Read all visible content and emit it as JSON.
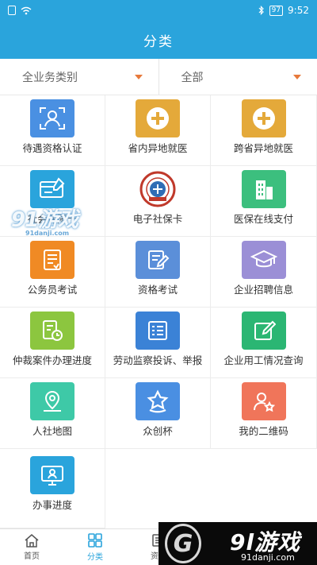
{
  "status_bar": {
    "battery": "97",
    "time": "9:52"
  },
  "header": {
    "title": "分类"
  },
  "filters": [
    {
      "label": "全业务类别"
    },
    {
      "label": "全部"
    }
  ],
  "services": [
    {
      "label": "待遇资格认证",
      "icon": "face-scan-icon",
      "color": "#4a90e2"
    },
    {
      "label": "省内异地就医",
      "icon": "medical-cross-icon",
      "color": "#e4a93a"
    },
    {
      "label": "跨省异地就医",
      "icon": "medical-cross-icon",
      "color": "#e4a93a"
    },
    {
      "label": "社会保障卡",
      "icon": "card-icon",
      "color": "#2aa4dc"
    },
    {
      "label": "电子社保卡",
      "icon": "social-security-seal-icon",
      "color": "#c0392b"
    },
    {
      "label": "医保在线支付",
      "icon": "building-icon",
      "color": "#3cbf7e"
    },
    {
      "label": "公务员考试",
      "icon": "exam-paper-icon",
      "color": "#f08a24"
    },
    {
      "label": "资格考试",
      "icon": "edit-document-icon",
      "color": "#5b8fd9"
    },
    {
      "label": "企业招聘信息",
      "icon": "graduation-cap-icon",
      "color": "#9b8fd6"
    },
    {
      "label": "仲裁案件办理进度",
      "icon": "document-clock-icon",
      "color": "#8cc63f"
    },
    {
      "label": "劳动监察投诉、举报",
      "icon": "complaint-list-icon",
      "color": "#3b82d6"
    },
    {
      "label": "企业用工情况查询",
      "icon": "pen-edit-icon",
      "color": "#2bb673"
    },
    {
      "label": "人社地图",
      "icon": "map-pin-icon",
      "color": "#3ec9a7"
    },
    {
      "label": "众创杯",
      "icon": "star-cup-icon",
      "color": "#4a8fe2"
    },
    {
      "label": "我的二维码",
      "icon": "user-star-icon",
      "color": "#f0755a"
    },
    {
      "label": "办事进度",
      "icon": "monitor-user-icon",
      "color": "#2aa4dc"
    }
  ],
  "watermark": {
    "text": "91游戏",
    "sub": "91danji.com"
  },
  "tabs": [
    {
      "label": "首页",
      "icon": "home-icon"
    },
    {
      "label": "分类",
      "icon": "grid-icon"
    },
    {
      "label": "资讯",
      "icon": "news-icon"
    }
  ],
  "brand": {
    "mark": "G",
    "text": "9l游戏",
    "url": "91danji.com"
  },
  "colors": {
    "primary": "#2aa4dc",
    "filter_arrow": "#e7793b"
  }
}
